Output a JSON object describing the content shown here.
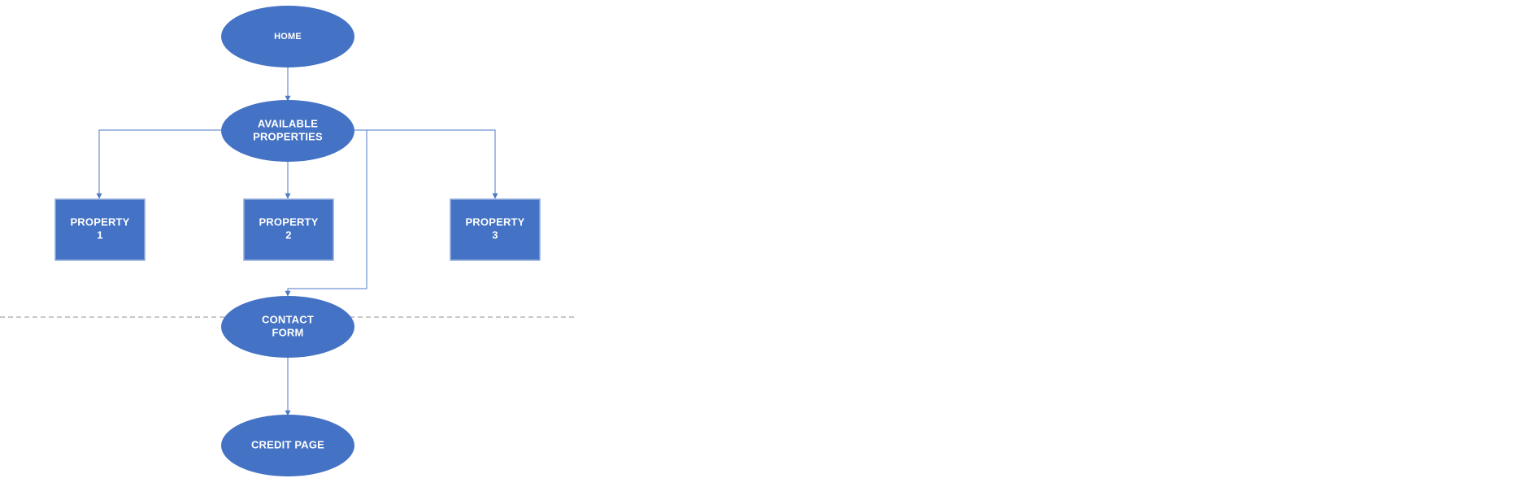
{
  "diagram": {
    "type": "sitemap-flowchart",
    "colors": {
      "node_fill": "#4472c4",
      "node_text": "#ffffff",
      "connector": "#4f7ac7",
      "separator": "#a6a6a6"
    },
    "nodes": {
      "home": {
        "shape": "ellipse",
        "lines": [
          "HOME"
        ]
      },
      "available_properties": {
        "shape": "ellipse",
        "lines": [
          "AVAILABLE",
          "PROPERTIES"
        ]
      },
      "property_1": {
        "shape": "rectangle",
        "lines": [
          "PROPERTY",
          "1"
        ]
      },
      "property_2": {
        "shape": "rectangle",
        "lines": [
          "PROPERTY",
          "2"
        ]
      },
      "property_3": {
        "shape": "rectangle",
        "lines": [
          "PROPERTY",
          "3"
        ]
      },
      "contact_form": {
        "shape": "ellipse",
        "lines": [
          "CONTACT",
          "FORM"
        ]
      },
      "credit_page": {
        "shape": "ellipse",
        "lines": [
          "CREDIT PAGE"
        ]
      }
    },
    "edges": [
      {
        "from": "home",
        "to": "available_properties"
      },
      {
        "from": "available_properties",
        "to": "property_1"
      },
      {
        "from": "available_properties",
        "to": "property_2"
      },
      {
        "from": "available_properties",
        "to": "property_3"
      },
      {
        "from": "available_properties",
        "to": "contact_form"
      },
      {
        "from": "contact_form",
        "to": "credit_page"
      }
    ],
    "separator": {
      "style": "dashed"
    }
  }
}
